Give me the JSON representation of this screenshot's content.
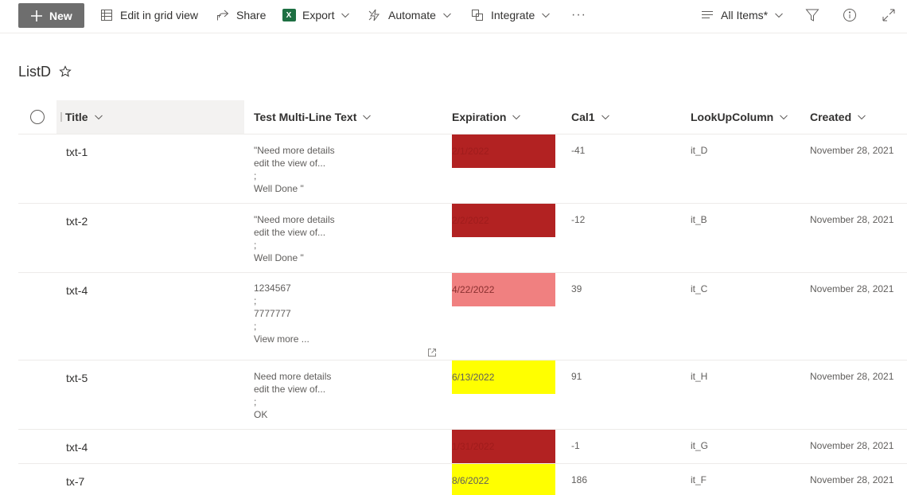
{
  "commandbar": {
    "new_label": "New",
    "edit_grid_label": "Edit in grid view",
    "share_label": "Share",
    "export_label": "Export",
    "export_icon_text": "X",
    "automate_label": "Automate",
    "integrate_label": "Integrate",
    "more_label": "···",
    "view_label": "All Items*"
  },
  "list": {
    "title": "ListD"
  },
  "columns": {
    "title": "Title",
    "multiline": "Test Multi-Line Text",
    "expiration": "Expiration",
    "cal": "Cal1",
    "lookup": "LookUpColumn",
    "created": "Created"
  },
  "colors": {
    "expired": "#b22222",
    "near": "#f08080",
    "future": "#ffff00",
    "new_button": "#6e6e6e"
  },
  "rows": [
    {
      "title": "txt-1",
      "mlt": [
        "\"Need more details",
        "edit the view of...",
        ";",
        "Well Done \""
      ],
      "expiration": "2/1/2022",
      "exp_status": "expired",
      "cal": "-41",
      "lookup": "it_D",
      "created": "November 28, 2021"
    },
    {
      "title": "txt-2",
      "mlt": [
        "\"Need more details",
        "edit the view of...",
        ";",
        "Well Done \""
      ],
      "expiration": "2/2/2022",
      "exp_status": "expired",
      "cal": "-12",
      "lookup": "it_B",
      "created": "November 28, 2021"
    },
    {
      "title": "txt-4",
      "mlt": [
        "1234567",
        ";",
        "7777777",
        ";",
        "View more ..."
      ],
      "expiration": "4/22/2022",
      "exp_status": "near",
      "cal": "39",
      "lookup": "it_C",
      "created": "November 28, 2021"
    },
    {
      "title": "txt-5",
      "mlt": [
        "Need more details",
        "edit the view of...",
        ";",
        "OK"
      ],
      "expiration": "6/13/2022",
      "exp_status": "future",
      "cal": "91",
      "lookup": "it_H",
      "created": "November 28, 2021"
    },
    {
      "title": "txt-4",
      "mlt": [],
      "expiration": "1/31/2022",
      "exp_status": "expired",
      "cal": "-1",
      "lookup": "it_G",
      "created": "November 28, 2021"
    },
    {
      "title": "tx-7",
      "mlt": [],
      "expiration": "8/6/2022",
      "exp_status": "future",
      "cal": "186",
      "lookup": "it_F",
      "created": "November 28, 2021"
    }
  ]
}
